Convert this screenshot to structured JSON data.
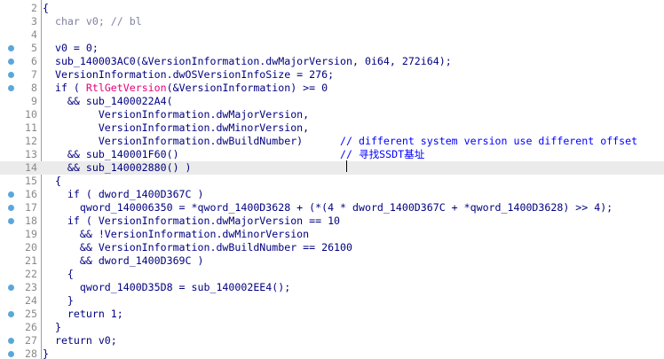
{
  "editor": {
    "top_fragment": "",
    "lines": [
      {
        "num": "2",
        "bp": false,
        "current": false,
        "segments": [
          {
            "t": "{",
            "c": "default"
          }
        ]
      },
      {
        "num": "3",
        "bp": false,
        "current": false,
        "segments": [
          {
            "t": "  char v0; // bl",
            "c": "gray"
          }
        ]
      },
      {
        "num": "4",
        "bp": false,
        "current": false,
        "segments": []
      },
      {
        "num": "5",
        "bp": true,
        "current": false,
        "segments": [
          {
            "t": "  v0 = 0;",
            "c": "default"
          }
        ]
      },
      {
        "num": "6",
        "bp": true,
        "current": false,
        "segments": [
          {
            "t": "  sub_140003AC0(&VersionInformation.dwMajorVersion, 0i64, 272i64);",
            "c": "default"
          }
        ]
      },
      {
        "num": "7",
        "bp": true,
        "current": false,
        "segments": [
          {
            "t": "  VersionInformation.dwOSVersionInfoSize = 276;",
            "c": "default"
          }
        ]
      },
      {
        "num": "8",
        "bp": true,
        "current": false,
        "segments": [
          {
            "t": "  if ( ",
            "c": "kw"
          },
          {
            "t": "RtlGetVersion",
            "c": "api"
          },
          {
            "t": "(&VersionInformation) >= 0",
            "c": "default"
          }
        ]
      },
      {
        "num": "9",
        "bp": false,
        "current": false,
        "segments": [
          {
            "t": "    && sub_1400022A4(",
            "c": "default"
          }
        ]
      },
      {
        "num": "10",
        "bp": false,
        "current": false,
        "segments": [
          {
            "t": "         VersionInformation.dwMajorVersion,",
            "c": "default"
          }
        ]
      },
      {
        "num": "11",
        "bp": false,
        "current": false,
        "segments": [
          {
            "t": "         VersionInformation.dwMinorVersion,",
            "c": "default"
          }
        ]
      },
      {
        "num": "12",
        "bp": false,
        "current": false,
        "segments": [
          {
            "t": "         VersionInformation.dwBuildNumber)      ",
            "c": "default"
          },
          {
            "t": "// different system version use different offset",
            "c": "comment"
          }
        ]
      },
      {
        "num": "13",
        "bp": false,
        "current": false,
        "segments": [
          {
            "t": "    && sub_140001F60()                          ",
            "c": "default"
          },
          {
            "t": "// 寻找SSDT基址",
            "c": "comment"
          }
        ]
      },
      {
        "num": "14",
        "bp": false,
        "current": true,
        "segments": [
          {
            "t": "    && sub_140002880() )",
            "c": "default"
          }
        ]
      },
      {
        "num": "15",
        "bp": false,
        "current": false,
        "segments": [
          {
            "t": "  {",
            "c": "default"
          }
        ]
      },
      {
        "num": "16",
        "bp": true,
        "current": false,
        "segments": [
          {
            "t": "    if ( dword_1400D367C )",
            "c": "default"
          }
        ]
      },
      {
        "num": "17",
        "bp": true,
        "current": false,
        "segments": [
          {
            "t": "      qword_140006350 = *qword_1400D3628 + (*(4 * dword_1400D367C + *qword_1400D3628) >> 4);",
            "c": "default"
          }
        ]
      },
      {
        "num": "18",
        "bp": true,
        "current": false,
        "segments": [
          {
            "t": "    if ( VersionInformation.dwMajorVersion == 10",
            "c": "default"
          }
        ]
      },
      {
        "num": "19",
        "bp": false,
        "current": false,
        "segments": [
          {
            "t": "      && !VersionInformation.dwMinorVersion",
            "c": "default"
          }
        ]
      },
      {
        "num": "20",
        "bp": false,
        "current": false,
        "segments": [
          {
            "t": "      && VersionInformation.dwBuildNumber == 26100",
            "c": "default"
          }
        ]
      },
      {
        "num": "21",
        "bp": false,
        "current": false,
        "segments": [
          {
            "t": "      && dword_1400D369C )",
            "c": "default"
          }
        ]
      },
      {
        "num": "22",
        "bp": false,
        "current": false,
        "segments": [
          {
            "t": "    {",
            "c": "default"
          }
        ]
      },
      {
        "num": "23",
        "bp": true,
        "current": false,
        "segments": [
          {
            "t": "      qword_1400D35D8 = sub_140002EE4();",
            "c": "default"
          }
        ]
      },
      {
        "num": "24",
        "bp": false,
        "current": false,
        "segments": [
          {
            "t": "    }",
            "c": "default"
          }
        ]
      },
      {
        "num": "25",
        "bp": true,
        "current": false,
        "segments": [
          {
            "t": "    return 1;",
            "c": "default"
          }
        ]
      },
      {
        "num": "26",
        "bp": false,
        "current": false,
        "segments": [
          {
            "t": "  }",
            "c": "default"
          }
        ]
      },
      {
        "num": "27",
        "bp": true,
        "current": false,
        "segments": [
          {
            "t": "  return v0;",
            "c": "default"
          }
        ]
      },
      {
        "num": "28",
        "bp": true,
        "current": false,
        "segments": [
          {
            "t": "}",
            "c": "default"
          }
        ]
      }
    ]
  },
  "colors": {
    "default": "#000080",
    "keyword": "#000080",
    "api": "#e6007a",
    "comment": "#0000ff",
    "line_number": "#8a8a8a",
    "breakpoint": "#5aa7dc",
    "current_line_bg": "#ebebeb"
  }
}
